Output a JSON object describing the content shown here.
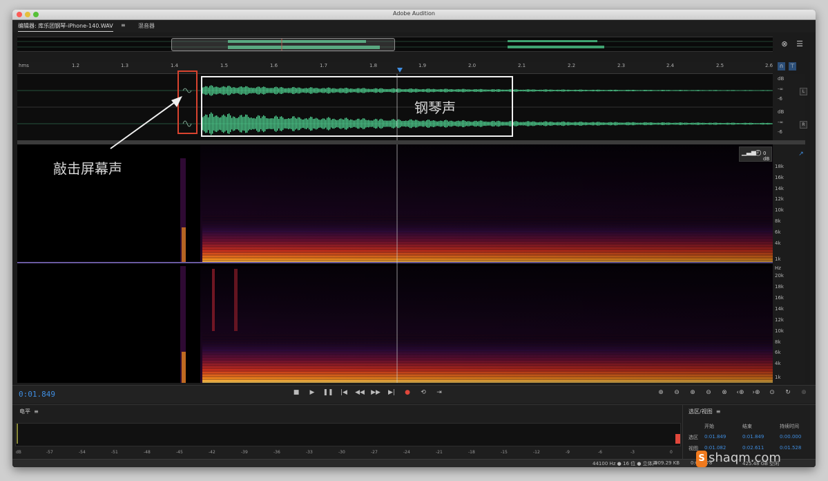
{
  "window": {
    "title": "Adobe Audition"
  },
  "tabs": {
    "editor": "编辑器: 库乐团钢琴-iPhone-140.WAV",
    "menu": "≡",
    "mixer": "混音器"
  },
  "ruler": {
    "unit": "hms",
    "ticks": [
      "1.2",
      "1.3",
      "1.4",
      "1.5",
      "1.6",
      "1.7",
      "1.8",
      "1.9",
      "2.0",
      "2.1",
      "2.2",
      "2.3",
      "2.4",
      "2.5",
      "2.6"
    ]
  },
  "db_scale": {
    "top_unit": "dB",
    "top_inf": "-∞",
    "top_six": "-6",
    "bot_unit": "dB",
    "bot_inf": "-∞",
    "bot_six": "-6",
    "left_tag": "L",
    "right_tag": "R"
  },
  "hz_scale": {
    "top": [
      "18k",
      "16k",
      "14k",
      "12k",
      "10k",
      "8k",
      "6k",
      "4k",
      "1k"
    ],
    "unit": "Hz",
    "bottom": [
      "20k",
      "18k",
      "16k",
      "14k",
      "12k",
      "10k",
      "8k",
      "6k",
      "4k",
      "1k"
    ]
  },
  "spec_tools": {
    "db_readout": "0 dB"
  },
  "transport": {
    "timecode": "0:01.849"
  },
  "levels": {
    "title": "电平",
    "menu": "≡",
    "scale": [
      "dB",
      "-57",
      "-54",
      "-51",
      "-48",
      "-45",
      "-42",
      "-39",
      "-36",
      "-33",
      "-30",
      "-27",
      "-24",
      "-21",
      "-18",
      "-15",
      "-12",
      "-9",
      "-6",
      "-3",
      "0"
    ]
  },
  "selection": {
    "title": "选区/视图",
    "menu": "≡",
    "headers": {
      "start": "开始",
      "end": "结束",
      "duration": "持续时间"
    },
    "rows": [
      {
        "label": "选区",
        "start": "0:01.849",
        "end": "0:01.849",
        "duration": "0:00.000"
      },
      {
        "label": "视图",
        "start": "0:01.082",
        "end": "0:02.611",
        "duration": "0:01.528"
      }
    ]
  },
  "status": {
    "format": "44100 Hz ● 16 位 ● 立体声",
    "size": "909.29 KB",
    "length": "0:05.278",
    "disk": "425.48 GB 空闲"
  },
  "annotations": {
    "tap_label": "敲击屏幕声",
    "piano_label": "钢琴声"
  },
  "watermark": {
    "text": "shaqm.com",
    "badge": "S"
  },
  "colors": {
    "accent": "#3f8de0",
    "waveform": "#4fd08f",
    "annotation_red": "#d9432f",
    "annotation_white": "#f0f0f0"
  }
}
